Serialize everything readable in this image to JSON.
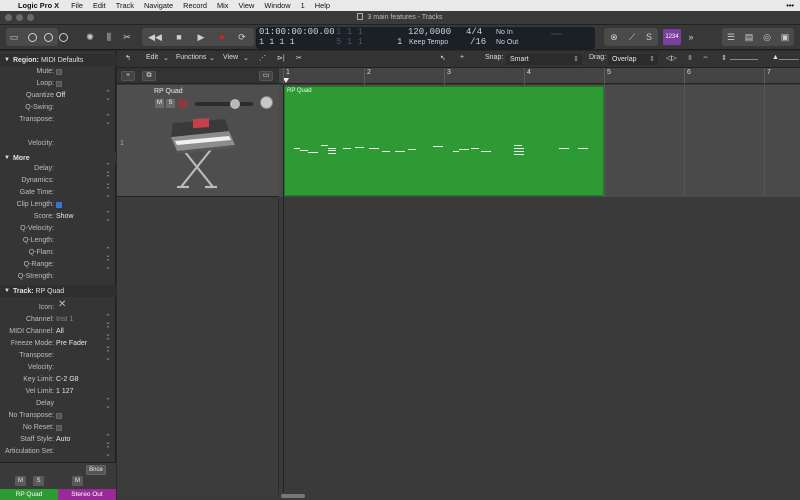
{
  "menubar": {
    "app": "Logic Pro X",
    "items": [
      "File",
      "Edit",
      "Track",
      "Navigate",
      "Record",
      "Mix",
      "View",
      "Window",
      "1",
      "Help"
    ]
  },
  "window": {
    "title": "3 main features - Tracks"
  },
  "lcd": {
    "time": "01:00:00:00.00",
    "bars": "1 1 1 1",
    "bars_dim": "1 1 1",
    "bars2": "5 1 1",
    "bars2_end": "1",
    "tempo": "120,0000",
    "tempo_label": "Keep Tempo",
    "sig_top": "4/4",
    "sig_bot": "/16",
    "in": "No In",
    "out": "No Out"
  },
  "control": {
    "tuner_badge": "1234"
  },
  "inspector": {
    "region": {
      "header": "Region:",
      "name": "MIDI Defaults",
      "rows": [
        {
          "label": "Mute:",
          "value": "",
          "type": "check"
        },
        {
          "label": "Loop:",
          "value": "",
          "type": "check"
        },
        {
          "label": "Quantize",
          "value": "Off",
          "type": "select"
        },
        {
          "label": "Q-Swing:",
          "value": "",
          "type": "plain"
        },
        {
          "label": "Transpose:",
          "value": "",
          "type": "stepper"
        },
        {
          "label": "",
          "value": "",
          "type": "spacer"
        },
        {
          "label": "Velocity:",
          "value": "",
          "type": "plain"
        }
      ]
    },
    "more": {
      "header": "More",
      "rows": [
        {
          "label": "Delay:",
          "value": "",
          "type": "stepper"
        },
        {
          "label": "Dynamics:",
          "value": "",
          "type": "stepper"
        },
        {
          "label": "Gate Time:",
          "value": "",
          "type": "stepper"
        },
        {
          "label": "Clip Length:",
          "value": "",
          "type": "checked"
        },
        {
          "label": "Score:",
          "value": "Show",
          "type": "select"
        },
        {
          "label": "Q-Velocity:",
          "value": "",
          "type": "plain"
        },
        {
          "label": "Q-Length:",
          "value": "",
          "type": "plain"
        },
        {
          "label": "Q-Flam:",
          "value": "",
          "type": "stepper"
        },
        {
          "label": "Q-Range:",
          "value": "",
          "type": "stepper"
        },
        {
          "label": "Q-Strength:",
          "value": "",
          "type": "plain"
        }
      ]
    },
    "track": {
      "header": "Track:",
      "name": "RP Quad",
      "rows": [
        {
          "label": "Icon:",
          "value": "",
          "type": "icon"
        },
        {
          "label": "Channel:",
          "value": "Inst 1",
          "type": "select-dim"
        },
        {
          "label": "MIDI Channel:",
          "value": "All",
          "type": "select"
        },
        {
          "label": "Freeze Mode:",
          "value": "Pre Fader",
          "type": "select"
        },
        {
          "label": "Transpose:",
          "value": "",
          "type": "stepper"
        },
        {
          "label": "Velocity:",
          "value": "",
          "type": "plain"
        },
        {
          "label": "Key Limit:",
          "value": "C-2  G8",
          "type": "plain"
        },
        {
          "label": "Vel Limit:",
          "value": "1  127",
          "type": "plain"
        },
        {
          "label": "Delay",
          "value": "",
          "type": "stepper"
        },
        {
          "label": "No Transpose:",
          "value": "",
          "type": "check"
        },
        {
          "label": "No Reset:",
          "value": "",
          "type": "check"
        },
        {
          "label": "Staff Style:",
          "value": "Auto",
          "type": "select"
        },
        {
          "label": "Articulation Set:",
          "value": "",
          "type": "select"
        }
      ]
    }
  },
  "strips": {
    "bnce": "Bnce",
    "m": "M",
    "s": "S",
    "left_name": "RP Quad",
    "right_name": "Stereo Out",
    "left_color": "#2d9a33",
    "right_color": "#9a2a9a"
  },
  "tracks_toolbar": {
    "edit": "Edit",
    "functions": "Functions",
    "view": "View",
    "snap_label": "Snap:",
    "snap_value": "Smart",
    "drag_label": "Drag:",
    "drag_value": "Overlap"
  },
  "ruler": {
    "bars": [
      "1",
      "2",
      "3",
      "4",
      "5",
      "6",
      "7"
    ]
  },
  "track": {
    "number": "1",
    "name": "RP Quad",
    "mute": "M",
    "solo": "S",
    "region_name": "RP Quad",
    "region_color": "#2d9a33"
  }
}
